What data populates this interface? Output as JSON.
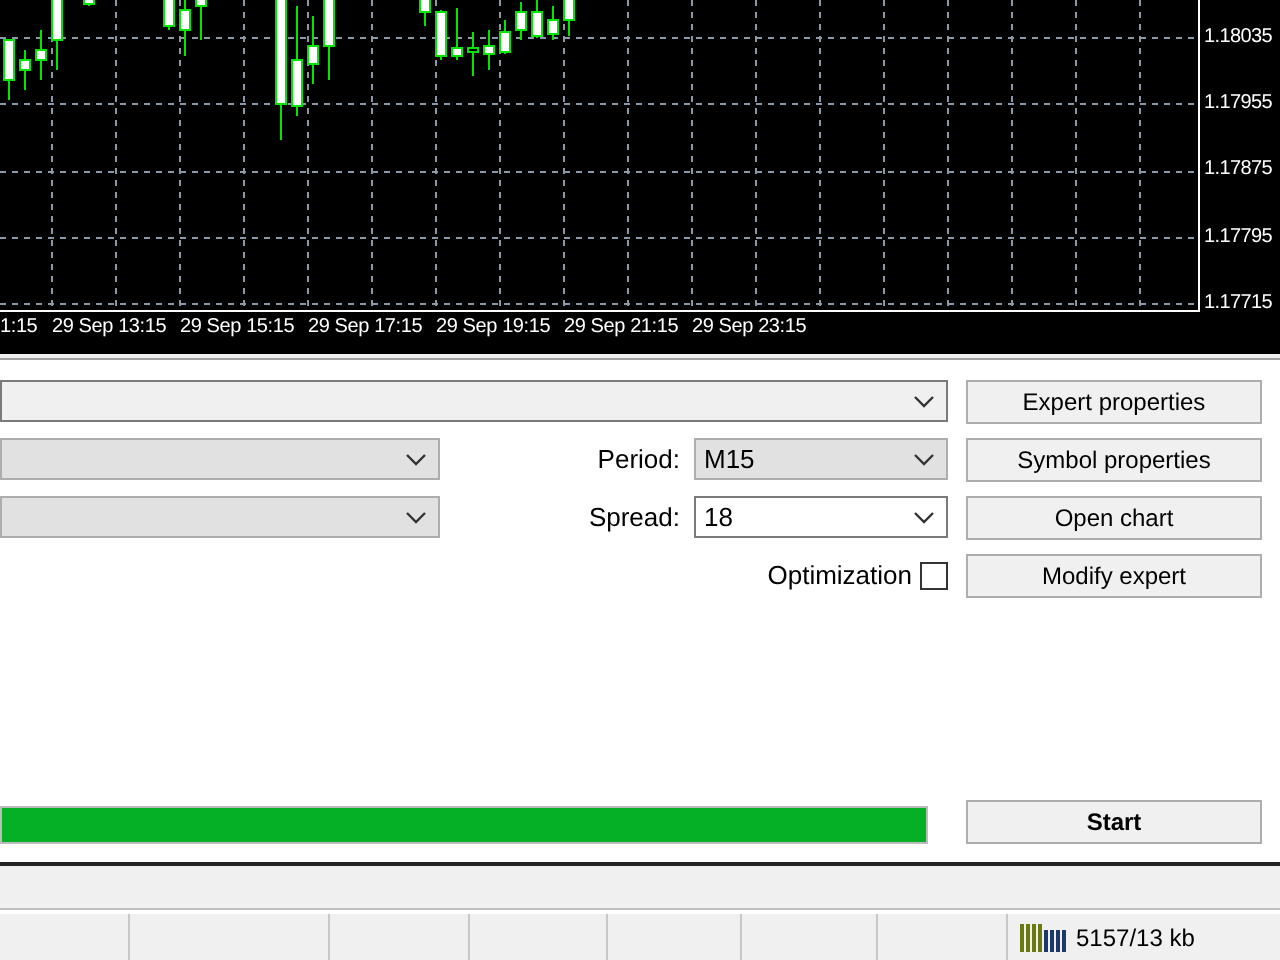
{
  "chart": {
    "price_labels": [
      "1.18035",
      "1.17955",
      "1.17875",
      "1.17795",
      "1.17715"
    ],
    "time_labels": [
      "1:15",
      "29 Sep 13:15",
      "29 Sep 15:15",
      "29 Sep 17:15",
      "29 Sep 19:15",
      "29 Sep 21:15",
      "29 Sep 23:15"
    ]
  },
  "settings": {
    "period": {
      "label": "Period:",
      "value": "M15"
    },
    "spread": {
      "label": "Spread:",
      "value": "18"
    },
    "optimization": {
      "label": "Optimization",
      "checked": false
    }
  },
  "buttons": [
    "Expert properties",
    "Symbol properties",
    "Open chart",
    "Modify expert"
  ],
  "progress": {
    "level": 1
  },
  "start_button": "Start",
  "status_bar": {
    "traffic": "5157/13 kb"
  }
}
